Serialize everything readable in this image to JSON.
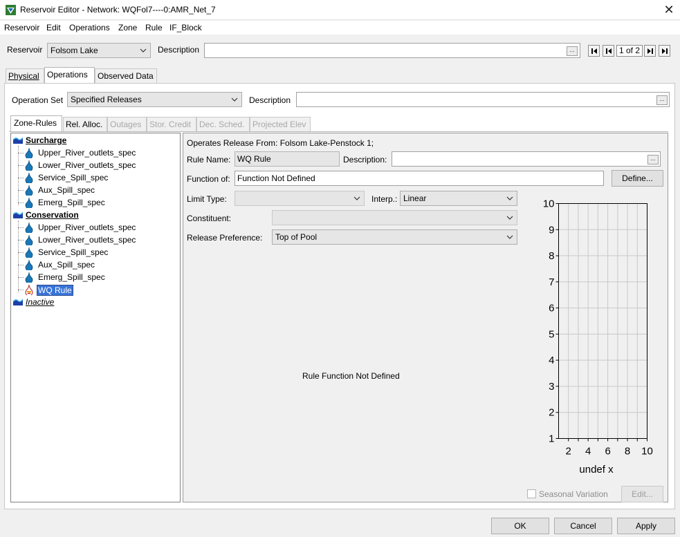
{
  "window": {
    "title": "Reservoir Editor - Network: WQFol7----0:AMR_Net_7",
    "close_glyph": "✕"
  },
  "menu": [
    "Reservoir",
    "Edit",
    "Operations",
    "Zone",
    "Rule",
    "IF_Block"
  ],
  "reservoir": {
    "label": "Reservoir",
    "value": "Folsom Lake",
    "description_label": "Description",
    "description_value": "",
    "dots": "...",
    "pager": "1 of 2"
  },
  "tabs": [
    "Physical",
    "Operations",
    "Observed Data"
  ],
  "operation_set": {
    "label": "Operation Set",
    "value": "Specified Releases",
    "description_label": "Description",
    "description_value": "",
    "dots": "..."
  },
  "subtabs": [
    {
      "label": "Zone-Rules",
      "state": "active"
    },
    {
      "label": "Rel. Alloc.",
      "state": "enabled"
    },
    {
      "label": "Outages",
      "state": "disabled"
    },
    {
      "label": "Stor. Credit",
      "state": "disabled"
    },
    {
      "label": "Dec. Sched.",
      "state": "disabled"
    },
    {
      "label": "Projected Elev",
      "state": "disabled"
    }
  ],
  "tree": {
    "zones": [
      {
        "name": "Surcharge",
        "children": [
          "Upper_River_outlets_spec",
          "Lower_River_outlets_spec",
          "Service_Spill_spec",
          "Aux_Spill_spec",
          "Emerg_Spill_spec"
        ]
      },
      {
        "name": "Conservation",
        "children": [
          "Upper_River_outlets_spec",
          "Lower_River_outlets_spec",
          "Service_Spill_spec",
          "Aux_Spill_spec",
          "Emerg_Spill_spec",
          "WQ Rule"
        ]
      },
      {
        "name": "Inactive",
        "children": []
      }
    ],
    "selected": "WQ Rule"
  },
  "rule": {
    "operates_from": "Operates Release From: Folsom Lake-Penstock 1;",
    "rule_name_label": "Rule Name:",
    "rule_name_value": "WQ Rule",
    "description_label": "Description:",
    "description_value": "",
    "dots": "...",
    "function_of_label": "Function of:",
    "function_of_value": "Function Not Defined",
    "define_button": "Define...",
    "limit_type_label": "Limit Type:",
    "limit_type_value": "",
    "interp_label": "Interp.:",
    "interp_value": "Linear",
    "constituent_label": "Constituent:",
    "constituent_value": "",
    "release_pref_label": "Release Preference:",
    "release_pref_value": "Top of Pool",
    "function_message": "Rule Function Not Defined",
    "seasonal_label": "Seasonal Variation",
    "seasonal_checked": false,
    "edit_button": "Edit..."
  },
  "chart_data": {
    "type": "line",
    "series": [],
    "xlabel": "undef x",
    "ylabel": "",
    "xlim": [
      1,
      10
    ],
    "ylim": [
      1,
      10
    ],
    "xticks": [
      2,
      4,
      6,
      8,
      10
    ],
    "yticks": [
      1,
      2,
      3,
      4,
      5,
      6,
      7,
      8,
      9,
      10
    ],
    "grid": true
  },
  "footer": {
    "ok": "OK",
    "cancel": "Cancel",
    "apply": "Apply"
  },
  "colors": {
    "selection": "#3874d8",
    "zone_icon": "#1c3fa8",
    "drop_icon": "#1a78b8"
  }
}
